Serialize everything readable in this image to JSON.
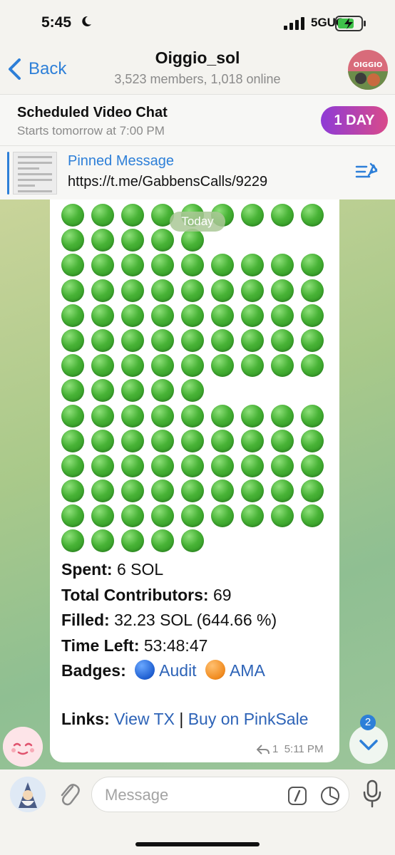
{
  "status_bar": {
    "time": "5:45",
    "network": "5GUC"
  },
  "header": {
    "back_label": "Back",
    "title": "Oiggio_sol",
    "subtitle": "3,523 members, 1,018 online",
    "avatar_text": "OIGGIO"
  },
  "video_chat": {
    "title": "Scheduled Video Chat",
    "subtitle": "Starts tomorrow at 7:00 PM",
    "button": "1 DAY"
  },
  "pinned": {
    "title": "Pinned Message",
    "text": "https://t.me/GabbensCalls/9229"
  },
  "chat": {
    "date_chip": "Today",
    "emoji_rows": [
      9,
      5,
      9,
      9,
      9,
      9,
      9,
      5,
      9,
      9,
      9,
      9,
      9,
      5
    ],
    "message": {
      "spent_label": "Spent:",
      "spent_value": "6 SOL",
      "contributors_label": "Total Contributors:",
      "contributors_value": "69",
      "filled_label": "Filled:",
      "filled_value": "32.23 SOL (644.66 %)",
      "time_left_label": "Time Left:",
      "time_left_value": "53:48:47",
      "badges_label": "Badges:",
      "badge_1": "Audit",
      "badge_2": "AMA",
      "links_label": "Links:",
      "link_tx": "View TX",
      "separator": "|",
      "link_buy": "Buy on PinkSale",
      "replies": "1",
      "time": "5:11 PM"
    },
    "unread_count": "2"
  },
  "input": {
    "placeholder": "Message"
  },
  "colors": {
    "accent": "#2d7fd8",
    "green_emoji": "#48b336",
    "gradient_start": "#8e3bd6",
    "gradient_end": "#d94a8a"
  }
}
